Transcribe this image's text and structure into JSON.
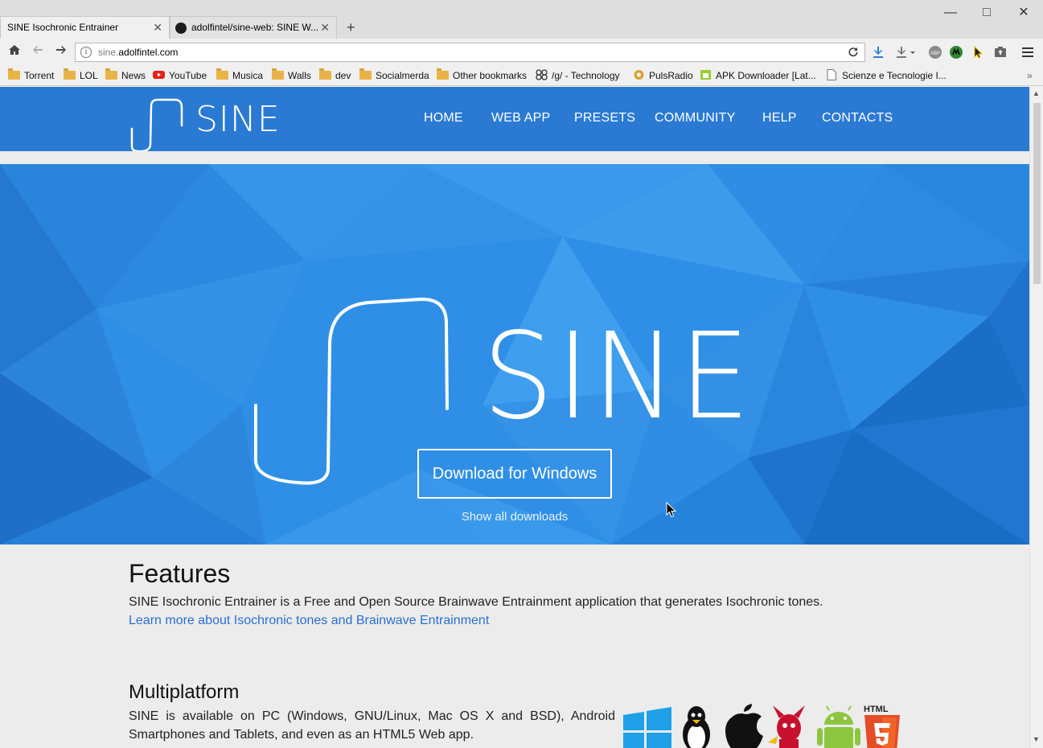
{
  "browser": {
    "tabs": [
      {
        "label": "SINE Isochronic Entrainer",
        "active": true
      },
      {
        "label": "adolfintel/sine-web: SINE W...",
        "active": false
      }
    ],
    "new_tab": "+",
    "window_controls": {
      "minimize": "—",
      "maximize": "□",
      "close": "✕"
    },
    "address": {
      "url_prefix": "sine.",
      "url_domain": "adolfintel.com",
      "info_icon": "i"
    },
    "bookmarks": [
      {
        "label": "Torrent",
        "icon": "folder-icon"
      },
      {
        "label": "LOL",
        "icon": "folder-icon"
      },
      {
        "label": "News",
        "icon": "folder-icon"
      },
      {
        "label": "YouTube",
        "icon": "youtube-icon"
      },
      {
        "label": "Musica",
        "icon": "folder-icon"
      },
      {
        "label": "Walls",
        "icon": "folder-icon"
      },
      {
        "label": "dev",
        "icon": "folder-icon"
      },
      {
        "label": "Socialmerda",
        "icon": "folder-icon"
      },
      {
        "label": "Other bookmarks",
        "icon": "folder-icon"
      },
      {
        "label": "/g/ - Technology",
        "icon": "clover-icon"
      },
      {
        "label": "PulsRadio",
        "icon": "radio-icon"
      },
      {
        "label": "APK Downloader [Lat...",
        "icon": "android-icon"
      },
      {
        "label": "Scienze e Tecnologie I...",
        "icon": "page-icon"
      }
    ],
    "overflow": "»"
  },
  "site": {
    "logo_text": "SINE",
    "nav": [
      "HOME",
      "WEB APP",
      "PRESETS",
      "COMMUNITY",
      "HELP",
      "CONTACTS"
    ],
    "hero": {
      "title": "SINE",
      "download_button": "Download for Windows",
      "show_all": "Show all downloads"
    },
    "features": {
      "title": "Features",
      "description": "SINE Isochronic Entrainer is a Free and Open Source Brainwave Entrainment application that generates Isochronic tones.",
      "link": "Learn more about Isochronic tones and Brainwave Entrainment"
    },
    "multiplatform": {
      "title": "Multiplatform",
      "description": "SINE is available on PC (Windows, GNU/Linux, Mac OS X and BSD), Android Smartphones and Tablets, and even as an HTML5 Web app.",
      "platform_icons": [
        "windows-icon",
        "linux-icon",
        "apple-icon",
        "bsd-icon",
        "android-icon",
        "html5-icon"
      ],
      "html5_label": "HTML"
    }
  },
  "colors": {
    "nav_bg": "#2a7ad4",
    "hero_bg": "#2f8fe6",
    "link": "#2a6ed4",
    "page_bg": "#ececec"
  }
}
